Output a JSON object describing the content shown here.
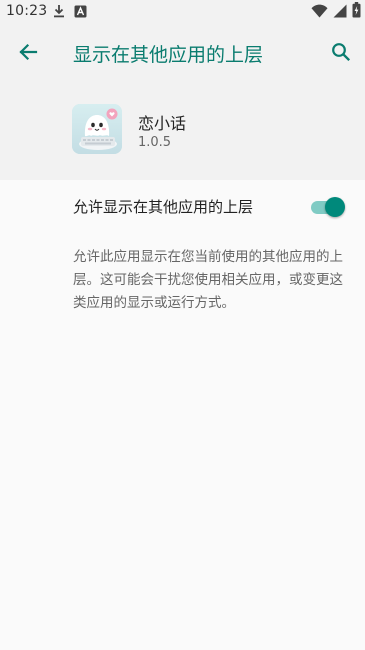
{
  "status_bar": {
    "time": "10:23",
    "left_icons": [
      "download-icon",
      "notification-a-icon"
    ],
    "right_icons": [
      "wifi-icon",
      "signal-icon",
      "battery-charging-icon"
    ]
  },
  "app_bar": {
    "title": "显示在其他应用的上层",
    "back_icon": "back-arrow-icon",
    "search_icon": "search-icon"
  },
  "app": {
    "name": "恋小话",
    "version": "1.0.5"
  },
  "permission": {
    "toggle_label": "允许显示在其他应用的上层",
    "enabled": true,
    "description": "允许此应用显示在您当前使用的其他应用的上层。这可能会干扰您使用相关应用，或变更这类应用的显示或运行方式。"
  },
  "colors": {
    "accent": "#00897b",
    "title": "#0a7c6f",
    "switch_track": "#80cbc4",
    "header_bg": "#f2f2f2",
    "page_bg": "#fafafa"
  }
}
